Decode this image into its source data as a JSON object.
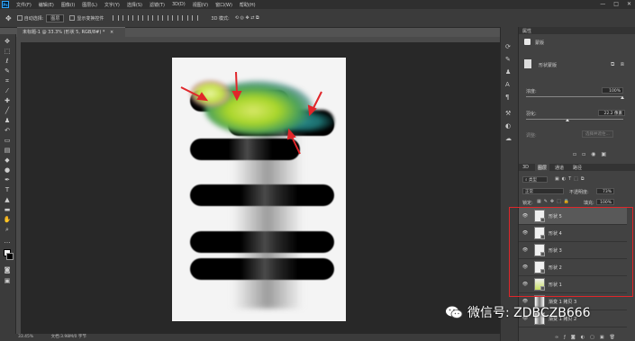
{
  "menubar": {
    "logo": "Ps",
    "items": [
      "文件(F)",
      "编辑(E)",
      "图像(I)",
      "图层(L)",
      "文字(Y)",
      "选择(S)",
      "滤镜(T)",
      "3D(D)",
      "视图(V)",
      "窗口(W)",
      "帮助(H)"
    ],
    "window_controls": [
      "—",
      "□",
      "✕"
    ]
  },
  "optionsbar": {
    "auto_select_label": "自动选择:",
    "auto_select_value": "图层",
    "show_transform_label": "显示变换控件",
    "mode_label": "3D 模式:"
  },
  "document": {
    "tab_title": "未标题-1 @ 33.3% (形状 5, RGB/8#) *",
    "close": "×"
  },
  "statusbar": {
    "zoom": "33.45%",
    "doc_info": "文档:3.98M/0 字节"
  },
  "properties": {
    "tab": "属性",
    "header": "蒙版",
    "subheader": "形状蒙版",
    "density_label": "浓度:",
    "density_value": "100%",
    "feather_label": "羽化:",
    "feather_value": "22.2 像素",
    "refine_label": "调整:",
    "refine_button": "选择并遮住..."
  },
  "layers": {
    "tabs": [
      "3D",
      "图层",
      "通道",
      "路径"
    ],
    "active_tab": "图层",
    "filter_kind": "类型",
    "blend_mode": "正常",
    "opacity_label": "不透明度:",
    "opacity_value": "73%",
    "lock_label": "锁定:",
    "fill_label": "填充:",
    "fill_value": "100%",
    "rows": [
      {
        "name": "形状 5",
        "selected": true
      },
      {
        "name": "形状 4",
        "selected": false
      },
      {
        "name": "形状 3",
        "selected": false
      },
      {
        "name": "形状 2",
        "selected": false
      },
      {
        "name": "形状 1",
        "selected": false
      },
      {
        "name": "渐变 1 拷贝 3",
        "selected": false
      },
      {
        "name": "渐变 1 拷贝 2",
        "selected": false
      }
    ],
    "bottom_icons": [
      "link-icon",
      "fx-icon",
      "mask-icon",
      "adjust-icon",
      "folder-icon",
      "new-icon",
      "trash-icon"
    ]
  },
  "watermark": {
    "text": "微信号: ZDBCZB666"
  },
  "colors": {
    "accent": "#e0262a",
    "panel_bg": "#424242",
    "canvas_bg": "#282828"
  }
}
